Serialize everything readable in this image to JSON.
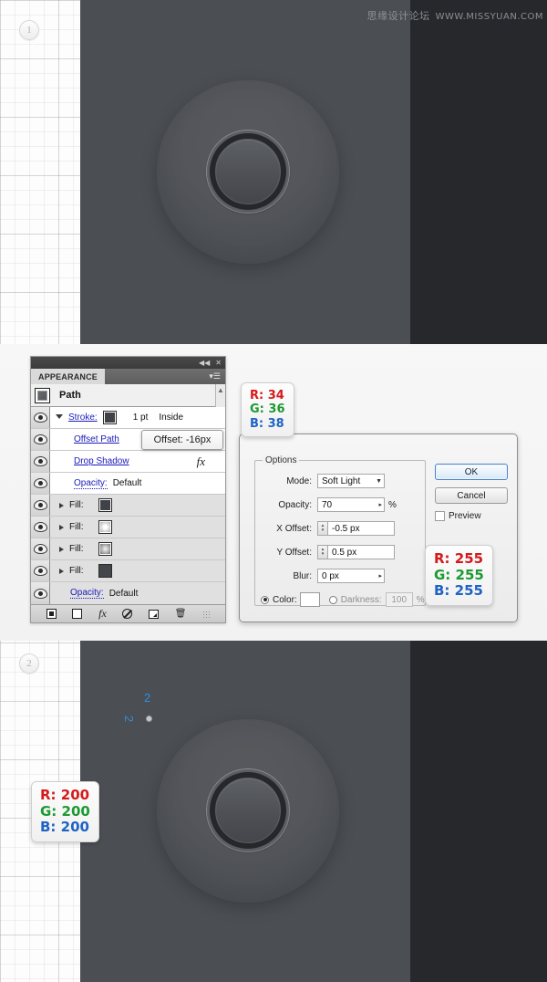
{
  "watermark": {
    "cn": "思缘设计论坛",
    "url": "WWW.MISSYUAN.COM"
  },
  "steps": {
    "one": "1",
    "two": "2"
  },
  "canvas2_labels": {
    "num": "2",
    "num_rotated": "2"
  },
  "panel": {
    "titlebar": {
      "collapse": "◀◀",
      "close": "✕"
    },
    "tab": "APPEARANCE",
    "menu_icon": "▾☰",
    "path_label": "Path",
    "scroll_up": "▲",
    "scroll_down": "▼",
    "rows": [
      {
        "name": "stroke",
        "label": "Stroke:",
        "value1": "1 pt",
        "value2": "Inside",
        "swatch": "dark-stroke-swatch"
      },
      {
        "name": "offset-path",
        "label": "Offset Path"
      },
      {
        "name": "drop-shadow",
        "label": "Drop Shadow",
        "fx": "fx"
      },
      {
        "name": "opacity-top",
        "label": "Opacity:",
        "value1": "Default"
      },
      {
        "name": "fill-1",
        "label": "Fill:",
        "swatch": "dark-square"
      },
      {
        "name": "fill-2",
        "label": "Fill:",
        "swatch": "radial-light"
      },
      {
        "name": "fill-3",
        "label": "Fill:",
        "swatch": "radial-dark"
      },
      {
        "name": "fill-4",
        "label": "Fill:",
        "swatch": "flat-dark"
      },
      {
        "name": "opacity-bottom",
        "label": "Opacity:",
        "value1": "Default"
      }
    ],
    "footer_icons": [
      "add-new-stroke-icon",
      "add-new-fill-icon",
      "add-new-effect-icon",
      "clear-appearance-icon",
      "duplicate-item-icon",
      "delete-item-icon"
    ],
    "footer_fx_label": "fx",
    "footer_trash_label": "🗑"
  },
  "tooltip": {
    "text": "Offset: -16px"
  },
  "dialog": {
    "legend": "Options",
    "fields": [
      {
        "name": "mode",
        "label": "Mode:",
        "value": "Soft Light",
        "type": "combo"
      },
      {
        "name": "opacity",
        "label": "Opacity:",
        "value": "70",
        "suffix": "%",
        "type": "stepper-text"
      },
      {
        "name": "x-offset",
        "label": "X Offset:",
        "value": "-0.5 px",
        "type": "spinner"
      },
      {
        "name": "y-offset",
        "label": "Y Offset:",
        "value": "0.5 px",
        "type": "spinner"
      },
      {
        "name": "blur",
        "label": "Blur:",
        "value": "0 px",
        "type": "stepper-text"
      }
    ],
    "color_radio_label": "Color:",
    "darkness_radio_label": "Darkness:",
    "darkness_value": "100",
    "darkness_suffix": "%",
    "color_value": "#ffffff",
    "buttons": {
      "ok": "OK",
      "cancel": "Cancel"
    },
    "preview_label": "Preview"
  },
  "badges": {
    "stroke_color": {
      "r": "R: 34",
      "g": "G: 36",
      "b": "B: 38"
    },
    "shadow_color": {
      "r": "R: 255",
      "g": "G: 255",
      "b": "B: 255"
    },
    "step2_color": {
      "r": "R: 200",
      "g": "G: 200",
      "b": "B: 200"
    }
  },
  "colors": {
    "canvas_bg": "#4b4e53",
    "canvas_dark_strip": "#26282c",
    "accent_blue": "#2d8fe0",
    "link_blue": "#1b1bbb",
    "badge_red": "#d61a1a",
    "badge_green": "#1d9a32",
    "badge_blue": "#1f63c4"
  }
}
